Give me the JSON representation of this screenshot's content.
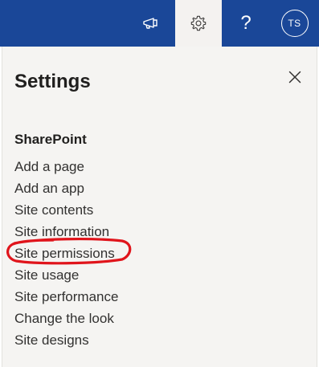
{
  "topbar": {
    "background_color": "#1a4798",
    "feedback_icon": "megaphone-icon",
    "settings_icon": "gear-icon",
    "help_label": "?",
    "avatar_initials": "TS"
  },
  "settings_panel": {
    "title": "Settings",
    "close_icon": "close-icon",
    "section_heading": "SharePoint",
    "items": [
      {
        "label": "Add a page"
      },
      {
        "label": "Add an app"
      },
      {
        "label": "Site contents"
      },
      {
        "label": "Site information"
      },
      {
        "label": "Site permissions"
      },
      {
        "label": "Site usage"
      },
      {
        "label": "Site performance"
      },
      {
        "label": "Change the look"
      },
      {
        "label": "Site designs"
      }
    ],
    "highlight_color": "#e0141b"
  }
}
